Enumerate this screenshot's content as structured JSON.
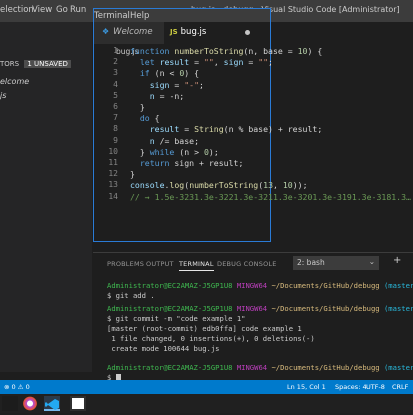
{
  "menubar": {
    "items": [
      "election",
      "View",
      "Go",
      "Run",
      "Terminal",
      "Help"
    ],
    "window_title": "bug.js - debugg - Visual Studio Code [Administrator]"
  },
  "sidebar": {
    "header": "TORS",
    "unsaved_badge": "1 UNSAVED",
    "items": [
      "elcome",
      "js"
    ]
  },
  "tabs": [
    {
      "label": "Welcome",
      "icon": "vscode-icon"
    },
    {
      "label": "bug.js",
      "icon": "js-file-icon",
      "dirty": true
    }
  ],
  "breadcrumb": "bug.js",
  "code": {
    "line_numbers": [
      "1",
      "2",
      "3",
      "4",
      "5",
      "6",
      "7",
      "8",
      "9",
      "10",
      "11",
      "12",
      "13",
      "14"
    ],
    "lines": [
      {
        "parts": [
          [
            "kw",
            "function "
          ],
          [
            "fn",
            "numberToString"
          ],
          [
            "",
            "(n, base = "
          ],
          [
            "num",
            "10"
          ],
          [
            "",
            ") {"
          ]
        ]
      },
      {
        "parts": [
          [
            "",
            "  "
          ],
          [
            "kw",
            "let "
          ],
          [
            "id",
            "result"
          ],
          [
            "",
            " = "
          ],
          [
            "str",
            "\"\""
          ],
          [
            "",
            ", "
          ],
          [
            "id",
            "sign"
          ],
          [
            "",
            " = "
          ],
          [
            "str",
            "\"\""
          ],
          [
            "",
            ";"
          ]
        ]
      },
      {
        "parts": [
          [
            "",
            "  "
          ],
          [
            "kw",
            "if "
          ],
          [
            "",
            "(n < "
          ],
          [
            "num",
            "0"
          ],
          [
            "",
            ") {"
          ]
        ]
      },
      {
        "parts": [
          [
            "",
            "    "
          ],
          [
            "id",
            "sign"
          ],
          [
            "",
            " = "
          ],
          [
            "str",
            "\"-\""
          ],
          [
            "",
            ";"
          ]
        ]
      },
      {
        "parts": [
          [
            "",
            "    "
          ],
          [
            "id",
            "n"
          ],
          [
            "",
            " = -n;"
          ]
        ]
      },
      {
        "parts": [
          [
            "",
            "  }"
          ]
        ]
      },
      {
        "parts": [
          [
            "",
            "  "
          ],
          [
            "kw",
            "do "
          ],
          [
            "",
            "{"
          ]
        ]
      },
      {
        "parts": [
          [
            "",
            "    "
          ],
          [
            "id",
            "result"
          ],
          [
            "",
            " = "
          ],
          [
            "fn",
            "String"
          ],
          [
            "",
            "(n % base) + result;"
          ]
        ]
      },
      {
        "parts": [
          [
            "",
            "    "
          ],
          [
            "id",
            "n"
          ],
          [
            "",
            " /= base;"
          ]
        ]
      },
      {
        "parts": [
          [
            "",
            "  } "
          ],
          [
            "kw",
            "while "
          ],
          [
            "",
            "(n > "
          ],
          [
            "num",
            "0"
          ],
          [
            "",
            ");"
          ]
        ]
      },
      {
        "parts": [
          [
            "",
            "  "
          ],
          [
            "kw",
            "return "
          ],
          [
            "",
            "sign + result;"
          ]
        ]
      },
      {
        "parts": [
          [
            "",
            "}"
          ]
        ]
      },
      {
        "parts": [
          [
            "id",
            "console"
          ],
          [
            "",
            "."
          ],
          [
            "fn",
            "log"
          ],
          [
            "",
            "("
          ],
          [
            "fn",
            "numberToString"
          ],
          [
            "",
            "("
          ],
          [
            "num",
            "13"
          ],
          [
            "",
            ", "
          ],
          [
            "num",
            "10"
          ],
          [
            "",
            "));"
          ]
        ]
      },
      {
        "parts": [
          [
            "cm",
            "// → 1.5e-3231.3e-3221.3e-3211.3e-3201.3e-3191.3e-3181.3…"
          ]
        ]
      }
    ]
  },
  "panel": {
    "tabs": [
      "PROBLEMS",
      "OUTPUT",
      "TERMINAL",
      "DEBUG CONSOLE"
    ],
    "active_tab": "TERMINAL",
    "terminal_select": "2: bash",
    "plus": "+"
  },
  "terminal": {
    "user": "Administrator@EC2AMAZ-J5GP1U8",
    "shell": "MINGW64",
    "path": "~/Documents/GitHub/debugg",
    "branch": "(master)",
    "prompt": "$",
    "cmd1": "git add .",
    "cmd2": "git commit -m \"code example 1\"",
    "out1": "[master (root-commit) edb0ffa] code example 1",
    "out2": " 1 file changed, 0 insertions(+), 0 deletions(-)",
    "out3": " create mode 100644 bug.js"
  },
  "statusbar": {
    "errors": "0",
    "warnings": "0",
    "position": "Ln 15, Col 1",
    "spaces": "Spaces: 4",
    "encoding": "UTF-8",
    "eol": "CRLF"
  },
  "colors": {
    "accent": "#007acc",
    "window_border": "#2a7bd6",
    "keyword": "#569cd6",
    "string": "#ce9178",
    "comment": "#6a9955"
  }
}
